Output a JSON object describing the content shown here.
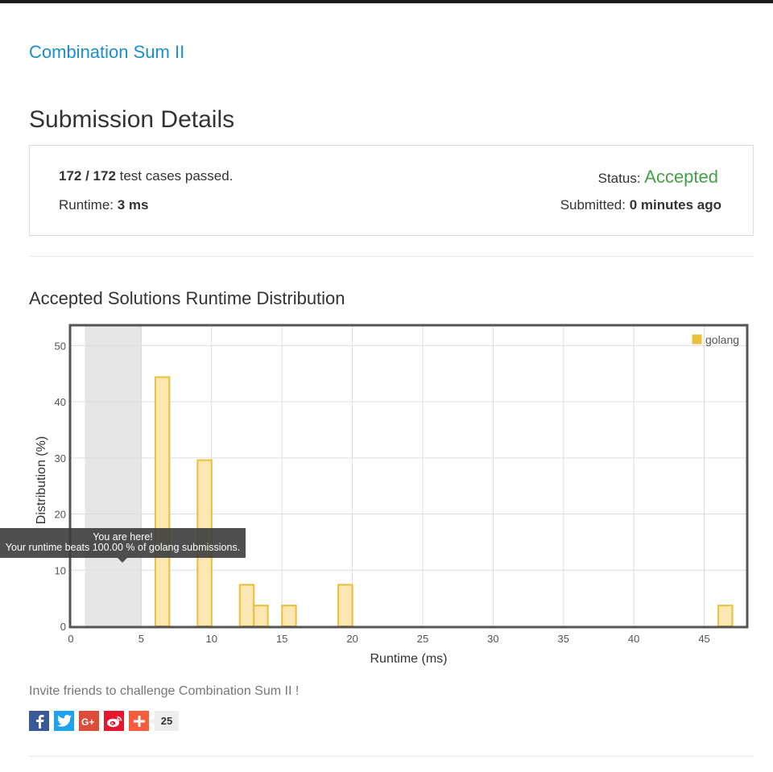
{
  "problem": {
    "title": "Combination Sum II"
  },
  "page": {
    "title": "Submission Details"
  },
  "details": {
    "passed": "172 / 172",
    "passed_suffix": " test cases passed.",
    "runtime_label": "Runtime: ",
    "runtime_value": "3 ms",
    "status_label": "Status: ",
    "status_value": "Accepted",
    "submitted_label": "Submitted: ",
    "submitted_value": "0 minutes ago"
  },
  "chart_section": {
    "title": "Accepted Solutions Runtime Distribution"
  },
  "chart_data": {
    "type": "bar",
    "xlabel": "Runtime (ms)",
    "ylabel": "Distribution (%)",
    "xlim": [
      0,
      48
    ],
    "ylim": [
      0,
      53.5
    ],
    "xticks": [
      0,
      5,
      10,
      15,
      20,
      25,
      30,
      35,
      40,
      45
    ],
    "yticks": [
      0,
      10,
      20,
      30,
      40,
      50
    ],
    "grid": true,
    "legend_position": "top-right",
    "bar_width": 1,
    "series": [
      {
        "name": "golang",
        "color": "#e9bf3b",
        "fill": "#fce7b2",
        "x": [
          6,
          9,
          12,
          13,
          15,
          19,
          46
        ],
        "values": [
          44.4,
          29.6,
          7.4,
          3.7,
          3.7,
          7.4,
          3.7
        ]
      }
    ],
    "highlight_range": [
      1,
      5
    ]
  },
  "tooltip": {
    "line1": "You are here!",
    "line2": "Your runtime beats 100.00 % of golang submissions."
  },
  "invite": {
    "text": "Invite friends to challenge Combination Sum II !"
  },
  "share": {
    "count": "25",
    "colors": {
      "facebook": "#3b5998",
      "twitter": "#1da1f2",
      "googleplus": "#dd4b39",
      "weibo": "#e6162d",
      "more": "#f65e3b"
    }
  }
}
